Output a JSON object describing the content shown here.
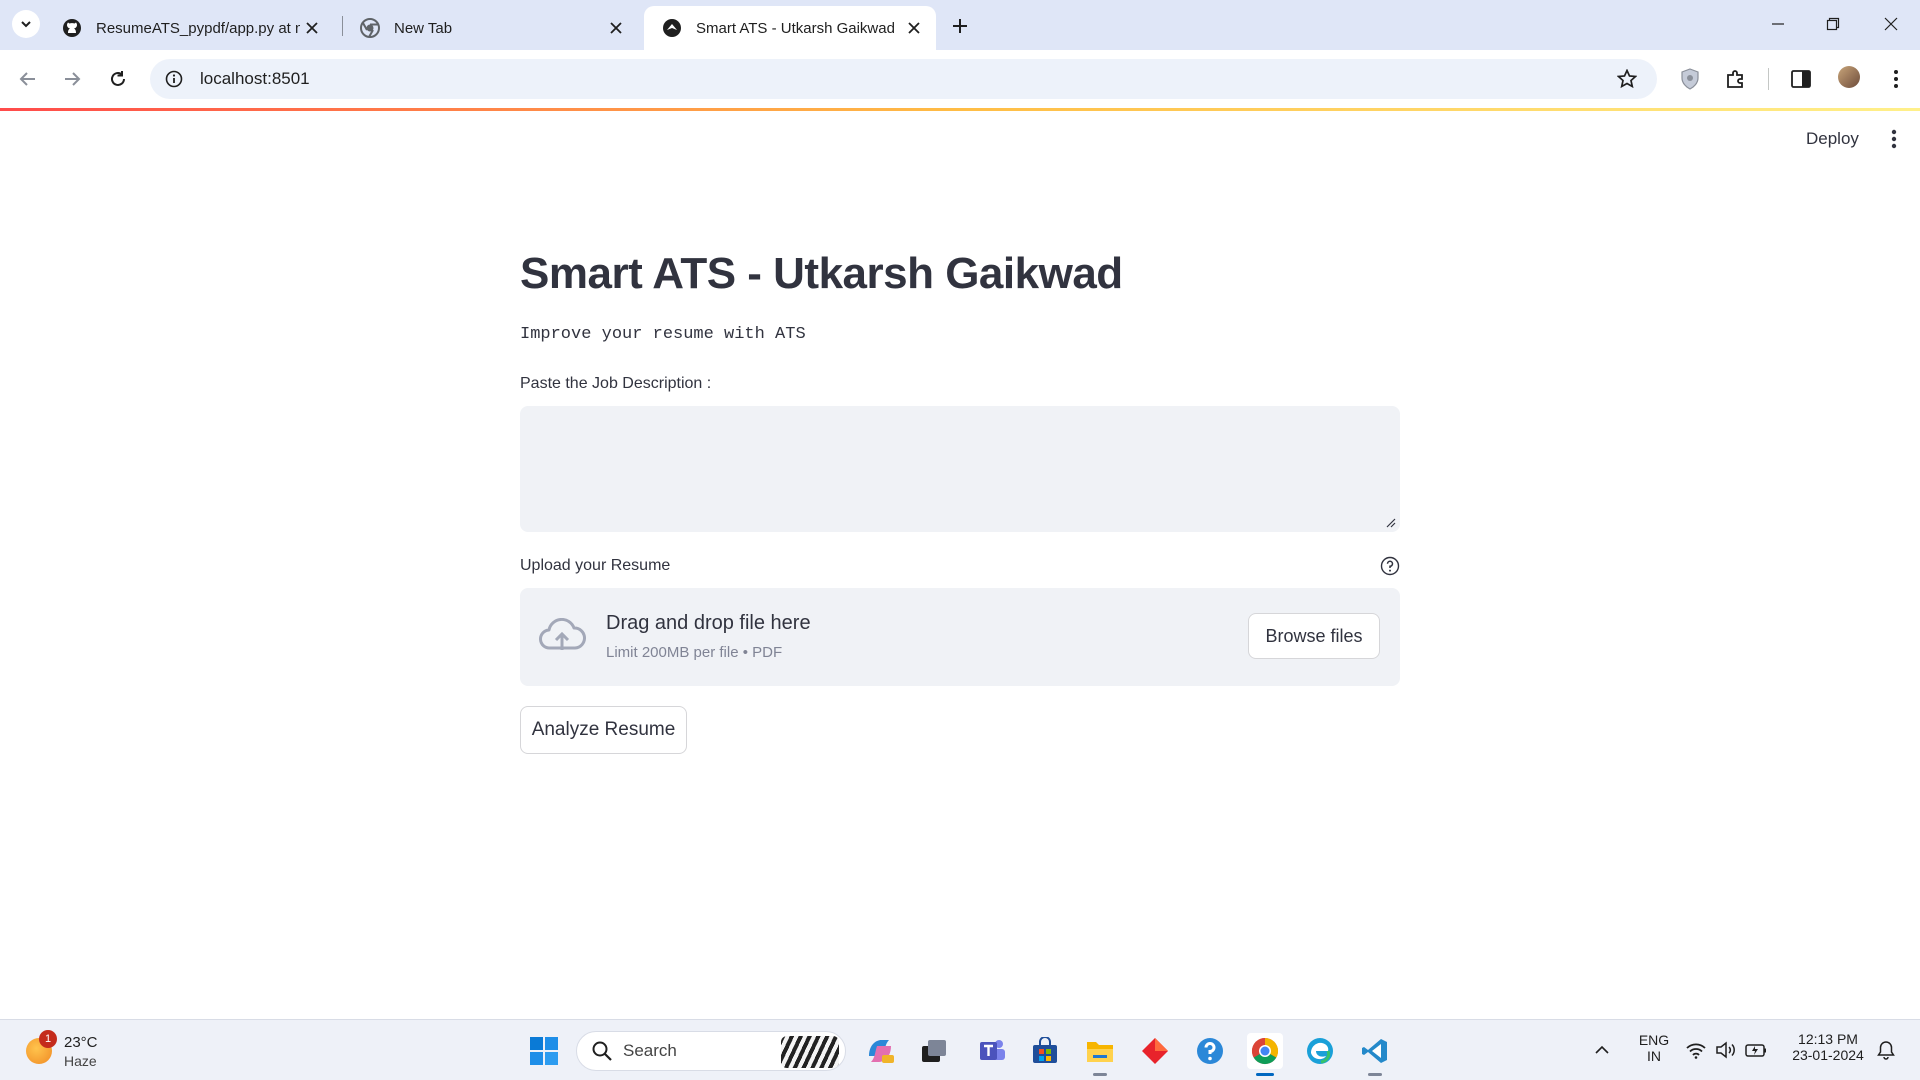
{
  "browser": {
    "tabs": [
      {
        "title": "ResumeATS_pypdf/app.py at ma",
        "favicon": "github-icon",
        "active": false
      },
      {
        "title": "New Tab",
        "favicon": "chrome-icon",
        "active": false
      },
      {
        "title": "Smart ATS - Utkarsh Gaikwad",
        "favicon": "streamlit-icon",
        "active": true
      }
    ],
    "url": "localhost:8501"
  },
  "header": {
    "deploy_label": "Deploy"
  },
  "app": {
    "title": "Smart ATS - Utkarsh Gaikwad",
    "subtitle": "Improve your resume with ATS",
    "jd_label": "Paste the Job Description :",
    "jd_value": "",
    "upload_label": "Upload your Resume",
    "dropzone_title": "Drag and drop file here",
    "dropzone_limit": "Limit 200MB per file • PDF",
    "browse_label": "Browse files",
    "analyze_label": "Analyze Resume"
  },
  "taskbar": {
    "weather_temp": "23°C",
    "weather_condition": "Haze",
    "weather_badge": "1",
    "search_label": "Search",
    "lang_line1": "ENG",
    "lang_line2": "IN",
    "time": "12:13 PM",
    "date": "23-01-2024"
  },
  "colors": {
    "accent_red": "#ff4b4b",
    "secondary_bg": "#f0f2f6",
    "text": "#31333f",
    "tabstrip_bg": "#dfe6f7"
  }
}
